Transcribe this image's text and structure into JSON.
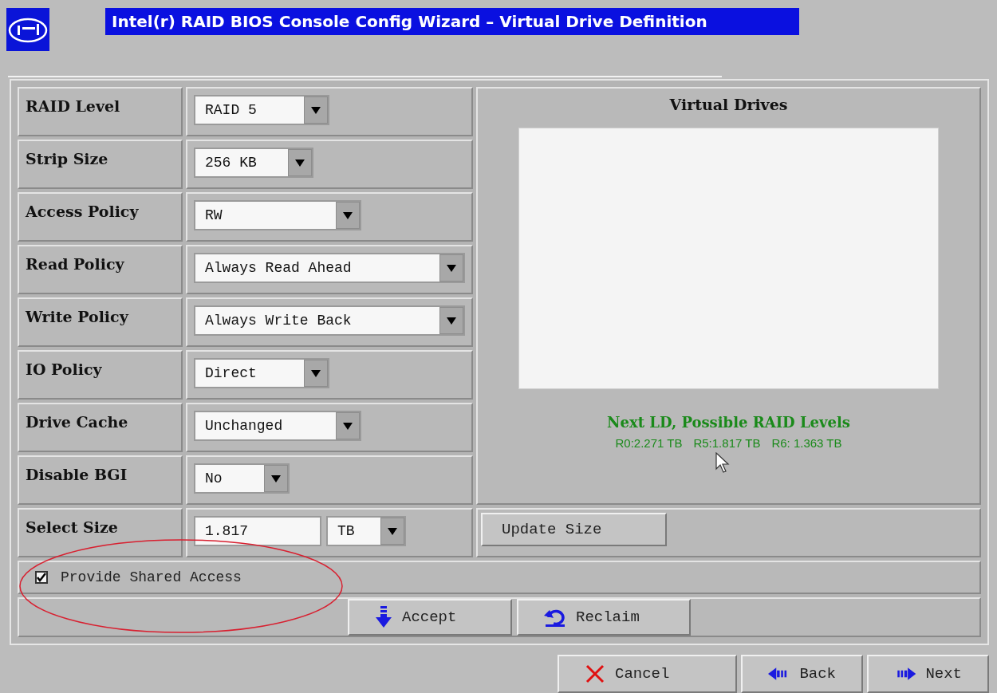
{
  "window": {
    "title": "Intel(r) RAID BIOS Console Config Wizard – Virtual Drive Definition"
  },
  "settings": [
    {
      "label": "RAID Level",
      "value": "RAID 5"
    },
    {
      "label": "Strip Size",
      "value": "256 KB"
    },
    {
      "label": "Access Policy",
      "value": "RW"
    },
    {
      "label": "Read Policy",
      "value": "Always Read Ahead"
    },
    {
      "label": "Write Policy",
      "value": "Always Write Back"
    },
    {
      "label": "IO Policy",
      "value": "Direct"
    },
    {
      "label": "Drive Cache",
      "value": "Unchanged"
    },
    {
      "label": "Disable BGI",
      "value": "No"
    }
  ],
  "select_size": {
    "label": "Select Size",
    "value": "1.817",
    "unit": "TB"
  },
  "update_button": "Update Size",
  "virtual_drives": {
    "title": "Virtual Drives"
  },
  "next_ld": {
    "heading": "Next LD, Possible RAID Levels",
    "levels": [
      "R0:2.271 TB",
      "R5:1.817 TB",
      "R6: 1.363 TB"
    ]
  },
  "shared_access": {
    "label": "Provide Shared Access",
    "checked": true
  },
  "actions": [
    {
      "label": "Accept",
      "kind": "accept"
    },
    {
      "label": "Reclaim",
      "kind": "reclaim"
    }
  ],
  "nav_buttons": [
    {
      "label": "Cancel",
      "kind": "cancel"
    },
    {
      "label": "Back",
      "kind": "back"
    },
    {
      "label": "Next",
      "kind": "next"
    }
  ]
}
